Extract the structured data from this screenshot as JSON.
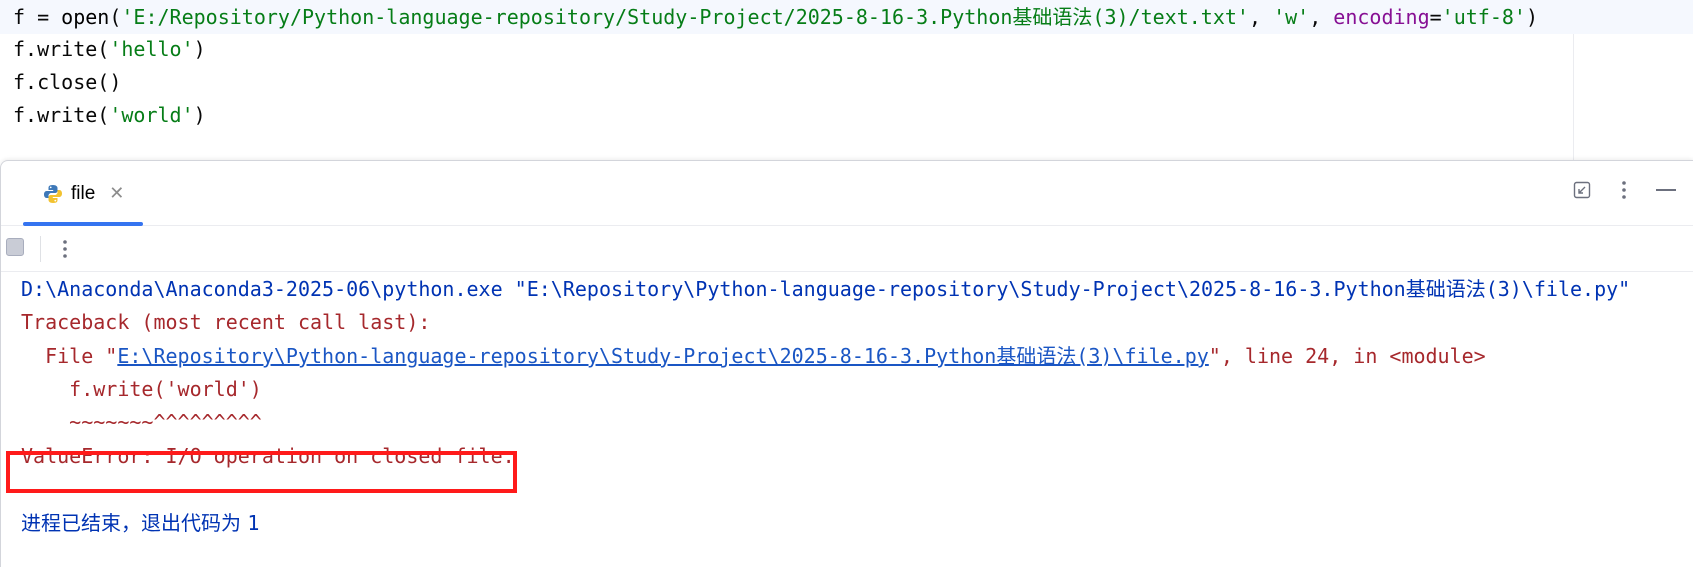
{
  "editor": {
    "lines": [
      {
        "var": "f",
        "op": " = ",
        "fn": "open",
        "path": "'E:/Repository/Python-language-repository/Study-Project/2025-8-16-3.Python基础语法(3)/text.txt'",
        "mode": "'w'",
        "kw": "encoding",
        "enc": "'utf-8'"
      },
      {
        "prefix": "f.write(",
        "arg": "'hello'",
        "suffix": ")"
      },
      {
        "text": "f.close()"
      },
      {
        "prefix": "f.write(",
        "arg": "'world'",
        "suffix": ")"
      }
    ]
  },
  "tool_window": {
    "tab": {
      "label": "file",
      "icon": "python-icon",
      "close_icon": "close-icon"
    },
    "actions": [
      "restore-layout-icon",
      "more-options-icon",
      "minimize-icon"
    ]
  },
  "toolbar": {
    "stop_icon": "stop-icon",
    "more_icon": "more-vertical-icon"
  },
  "console": {
    "command": "D:\\Anaconda\\Anaconda3-2025-06\\python.exe \"E:\\Repository\\Python-language-repository\\Study-Project\\2025-8-16-3.Python基础语法(3)\\file.py\"",
    "traceback_header": "Traceback (most recent call last):",
    "file_prefix": "  File \"",
    "file_link": "E:\\Repository\\Python-language-repository\\Study-Project\\2025-8-16-3.Python基础语法(3)\\file.py",
    "file_suffix": "\", line 24, in <module>",
    "source_line": "    f.write('world')",
    "caret_line": "    ~~~~~~~^^^^^^^^^",
    "error": "ValueError: I/O operation on closed file.",
    "exit_text": "进程已结束，退出代码为 ",
    "exit_code": "1"
  },
  "colors": {
    "accent": "#3574f0",
    "error_text": "#a6282c",
    "command_text": "#0033b3",
    "string": "#067d17",
    "keyword_arg": "#871094",
    "highlight_box": "#ff1a1a"
  }
}
